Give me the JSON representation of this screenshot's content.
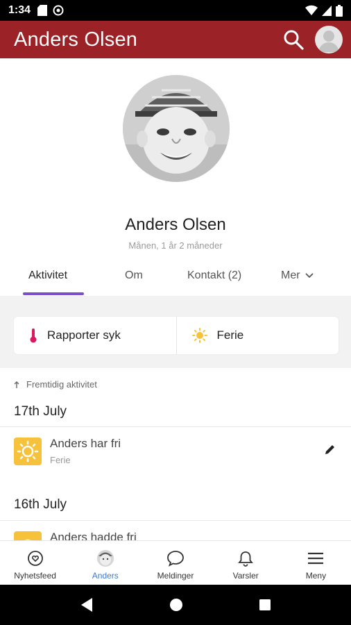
{
  "status_bar": {
    "time": "1:34"
  },
  "app_bar": {
    "title": "Anders Olsen"
  },
  "profile": {
    "name": "Anders Olsen",
    "subtitle": "Månen, 1 år 2 måneder"
  },
  "tabs": [
    {
      "label": "Aktivitet",
      "active": true
    },
    {
      "label": "Om",
      "active": false
    },
    {
      "label": "Kontakt (2)",
      "active": false
    },
    {
      "label": "Mer",
      "active": false
    }
  ],
  "quick_actions": [
    {
      "label": "Rapporter syk",
      "icon": "thermometer-icon"
    },
    {
      "label": "Ferie",
      "icon": "sun-icon"
    }
  ],
  "feed": {
    "future_link": "Fremtidig aktivitet",
    "groups": [
      {
        "date": "17th July",
        "items": [
          {
            "title": "Anders har fri",
            "subtitle": "Ferie",
            "icon": "sun-icon"
          }
        ]
      },
      {
        "date": "16th July",
        "items": [
          {
            "title": "Anders hadde fri",
            "subtitle": "",
            "icon": "sun-icon"
          }
        ]
      }
    ]
  },
  "bottom_nav": [
    {
      "label": "Nyhetsfeed",
      "icon": "newsfeed-icon",
      "active": false
    },
    {
      "label": "Anders",
      "icon": "child-avatar-icon",
      "active": true
    },
    {
      "label": "Meldinger",
      "icon": "chat-bubble-icon",
      "active": false
    },
    {
      "label": "Varsler",
      "icon": "bell-icon",
      "active": false
    },
    {
      "label": "Meny",
      "icon": "hamburger-menu-icon",
      "active": false
    }
  ],
  "colors": {
    "app_bar": "#9b2226",
    "tab_indicator": "#7b4fc9",
    "activity_icon": "#f7c23b",
    "nav_active": "#3a78d4"
  }
}
